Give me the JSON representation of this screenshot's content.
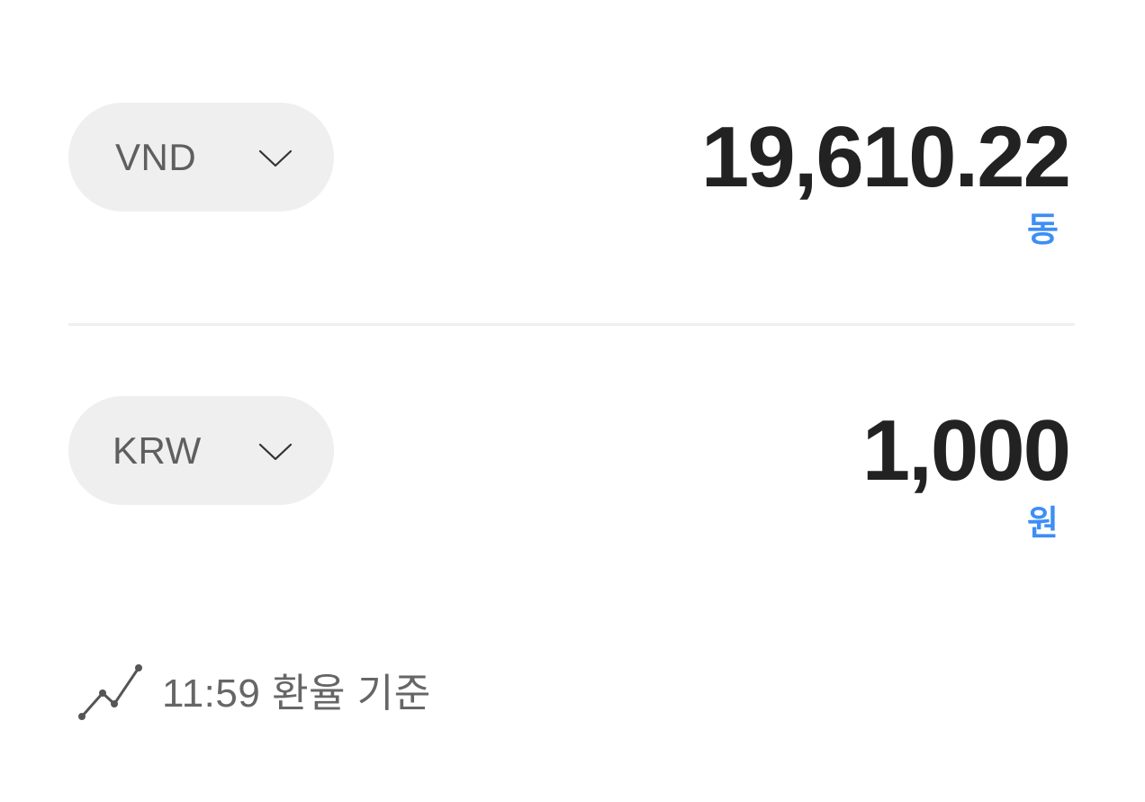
{
  "from": {
    "currency_code": "VND",
    "amount": "19,610.22",
    "unit": "동"
  },
  "to": {
    "currency_code": "KRW",
    "amount": "1,000",
    "unit": "원"
  },
  "rate_info": {
    "text": "11:59 환율 기준",
    "icon": "trend-line-icon"
  },
  "colors": {
    "accent": "#3d8ef5",
    "pill_bg": "#efefef",
    "amount_text": "#222222",
    "muted_text": "#666666"
  }
}
